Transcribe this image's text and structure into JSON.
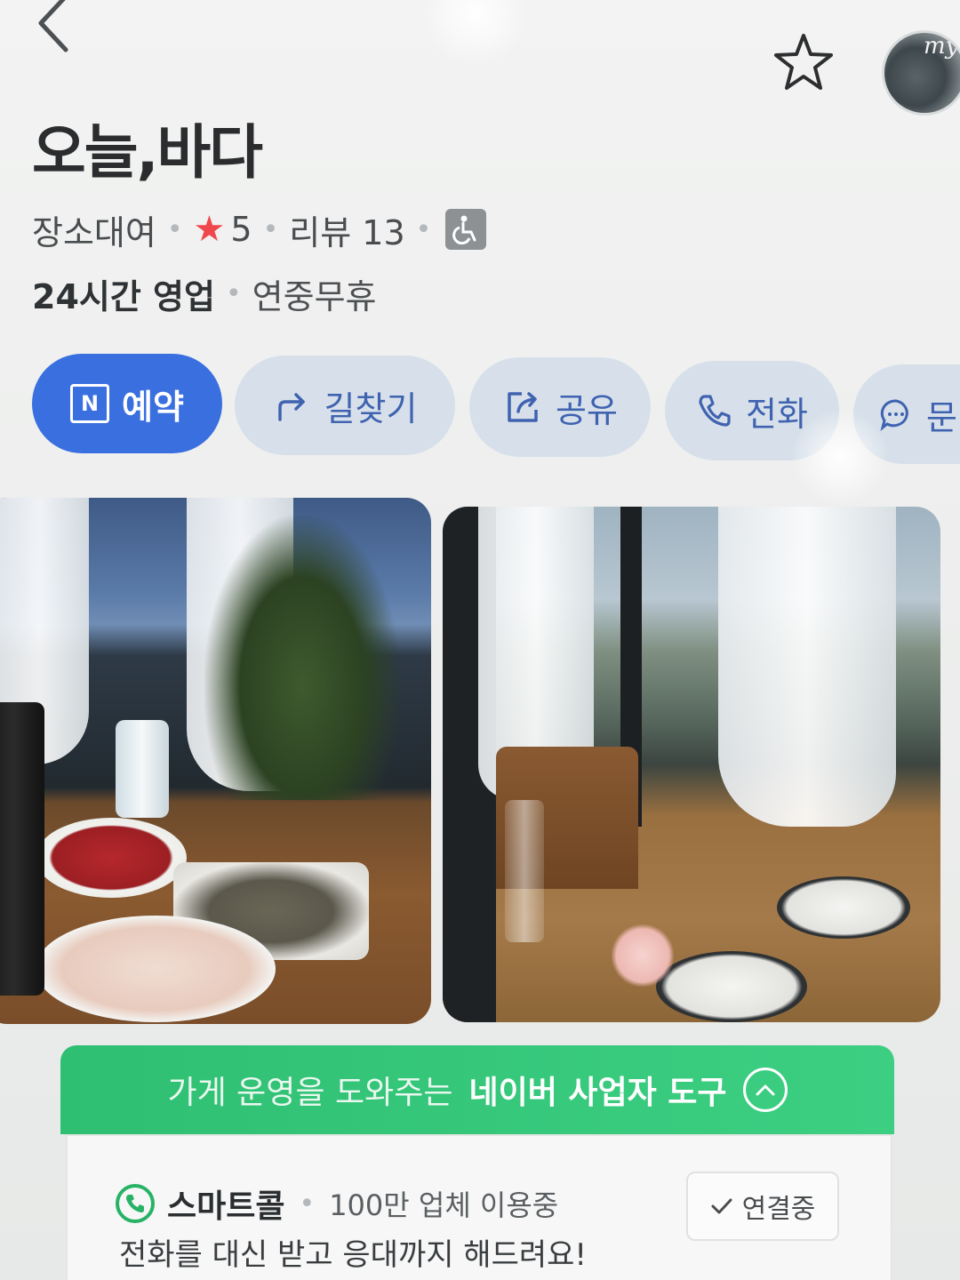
{
  "place": {
    "name": "오늘,바다",
    "category": "장소대여",
    "rating": "5",
    "reviews_label": "리뷰 13",
    "hours": "24시간 영업",
    "closed_days": "연중무휴"
  },
  "header": {
    "avatar_text": "my"
  },
  "actions": [
    {
      "label": "예약",
      "icon": "naver-calendar-icon"
    },
    {
      "label": "길찾기",
      "icon": "directions-icon"
    },
    {
      "label": "공유",
      "icon": "share-icon"
    },
    {
      "label": "전화",
      "icon": "phone-icon"
    },
    {
      "label": "문",
      "icon": "chat-bubble-icon"
    }
  ],
  "tools": {
    "banner_part1": "가게 운영을 도와주는",
    "banner_part2": "네이버 사업자 도구",
    "service_name": "스마트콜",
    "service_count": "100만 업체 이용중",
    "service_desc": "전화를 대신 받고 응대까지 해드려요!",
    "status_label": "연결중"
  },
  "colors": {
    "primary_blue": "#3a6fe0",
    "secondary_button": "#d7e0ea",
    "rating_star": "#f0474d",
    "naver_green": "#2fbf73"
  }
}
